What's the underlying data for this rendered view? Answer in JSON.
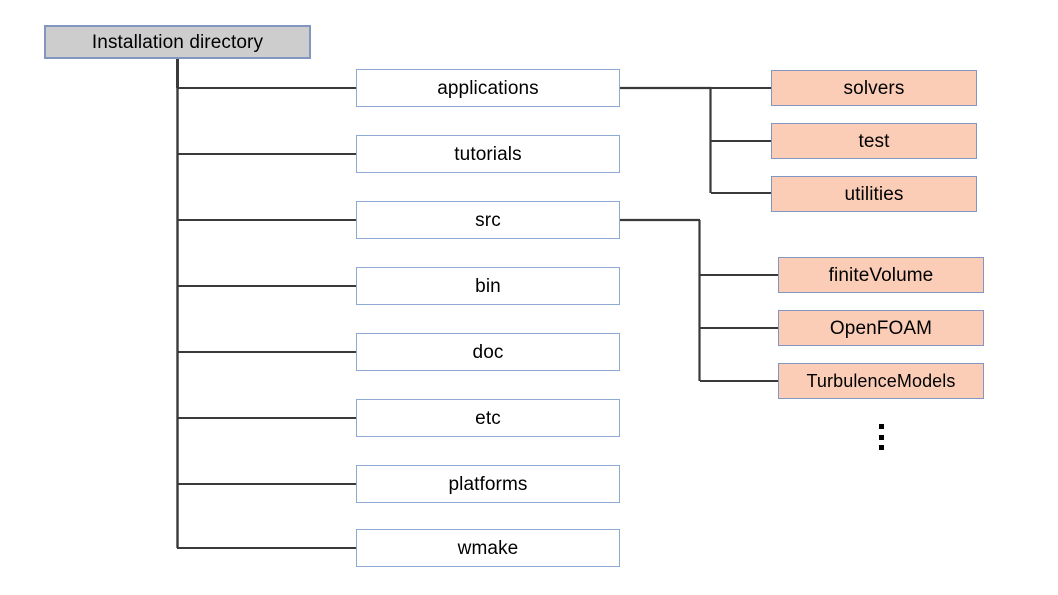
{
  "diagram": {
    "title": "Installation directory",
    "root": {
      "label": "Installation directory",
      "fill": "#cdcdcd",
      "stroke": "#8196c0"
    },
    "level1_fill": "#ffffff",
    "level1_stroke": "#8ea9d4",
    "level2_fill": "#fbcdb7",
    "level2_stroke": "#8196c0",
    "line_color": "#3a3a3a",
    "text_color": "#000000",
    "background": "#ffffff",
    "level1": [
      {
        "label": "applications"
      },
      {
        "label": "tutorials"
      },
      {
        "label": "src"
      },
      {
        "label": "bin"
      },
      {
        "label": "doc"
      },
      {
        "label": "etc"
      },
      {
        "label": "platforms"
      },
      {
        "label": "wmake"
      }
    ],
    "applications_children": [
      {
        "label": "solvers"
      },
      {
        "label": "test"
      },
      {
        "label": "utilities"
      }
    ],
    "src_children": [
      {
        "label": "finiteVolume"
      },
      {
        "label": "OpenFOAM"
      },
      {
        "label": "TurbulenceModels"
      }
    ],
    "src_more_indicator": "vertical-ellipsis"
  }
}
